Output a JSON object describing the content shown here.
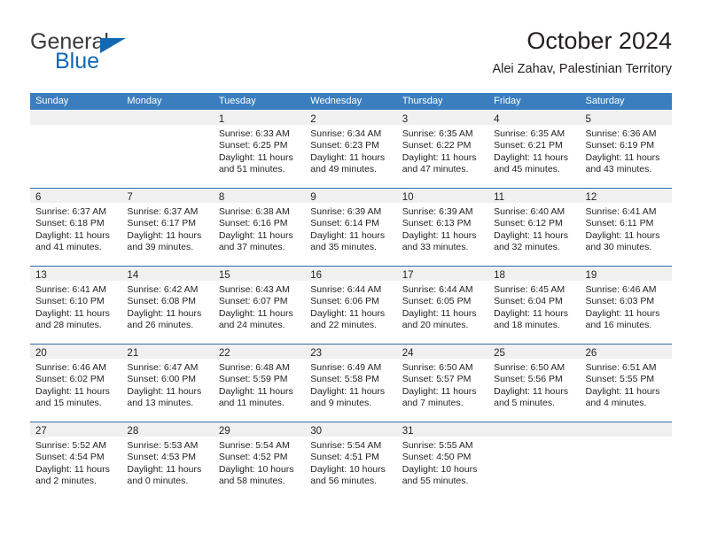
{
  "brand": {
    "name_part1": "General",
    "name_part2": "Blue",
    "triangle_icon": "triangle-icon",
    "accent_color": "#1268b3"
  },
  "header": {
    "title": "October 2024",
    "subtitle": "Alei Zahav, Palestinian Territory"
  },
  "theme": {
    "header_bar_color": "#3a7ebf",
    "week_rule_color": "#2e6da4",
    "day_band_color": "#f0f0f0",
    "text_color": "#231f20"
  },
  "calendar": {
    "weekdays": [
      "Sunday",
      "Monday",
      "Tuesday",
      "Wednesday",
      "Thursday",
      "Friday",
      "Saturday"
    ],
    "weeks": [
      [
        {
          "day": "",
          "empty": true
        },
        {
          "day": "",
          "empty": true
        },
        {
          "day": "1",
          "sunrise": "Sunrise: 6:33 AM",
          "sunset": "Sunset: 6:25 PM",
          "daylight": "Daylight: 11 hours and 51 minutes."
        },
        {
          "day": "2",
          "sunrise": "Sunrise: 6:34 AM",
          "sunset": "Sunset: 6:23 PM",
          "daylight": "Daylight: 11 hours and 49 minutes."
        },
        {
          "day": "3",
          "sunrise": "Sunrise: 6:35 AM",
          "sunset": "Sunset: 6:22 PM",
          "daylight": "Daylight: 11 hours and 47 minutes."
        },
        {
          "day": "4",
          "sunrise": "Sunrise: 6:35 AM",
          "sunset": "Sunset: 6:21 PM",
          "daylight": "Daylight: 11 hours and 45 minutes."
        },
        {
          "day": "5",
          "sunrise": "Sunrise: 6:36 AM",
          "sunset": "Sunset: 6:19 PM",
          "daylight": "Daylight: 11 hours and 43 minutes."
        }
      ],
      [
        {
          "day": "6",
          "sunrise": "Sunrise: 6:37 AM",
          "sunset": "Sunset: 6:18 PM",
          "daylight": "Daylight: 11 hours and 41 minutes."
        },
        {
          "day": "7",
          "sunrise": "Sunrise: 6:37 AM",
          "sunset": "Sunset: 6:17 PM",
          "daylight": "Daylight: 11 hours and 39 minutes."
        },
        {
          "day": "8",
          "sunrise": "Sunrise: 6:38 AM",
          "sunset": "Sunset: 6:16 PM",
          "daylight": "Daylight: 11 hours and 37 minutes."
        },
        {
          "day": "9",
          "sunrise": "Sunrise: 6:39 AM",
          "sunset": "Sunset: 6:14 PM",
          "daylight": "Daylight: 11 hours and 35 minutes."
        },
        {
          "day": "10",
          "sunrise": "Sunrise: 6:39 AM",
          "sunset": "Sunset: 6:13 PM",
          "daylight": "Daylight: 11 hours and 33 minutes."
        },
        {
          "day": "11",
          "sunrise": "Sunrise: 6:40 AM",
          "sunset": "Sunset: 6:12 PM",
          "daylight": "Daylight: 11 hours and 32 minutes."
        },
        {
          "day": "12",
          "sunrise": "Sunrise: 6:41 AM",
          "sunset": "Sunset: 6:11 PM",
          "daylight": "Daylight: 11 hours and 30 minutes."
        }
      ],
      [
        {
          "day": "13",
          "sunrise": "Sunrise: 6:41 AM",
          "sunset": "Sunset: 6:10 PM",
          "daylight": "Daylight: 11 hours and 28 minutes."
        },
        {
          "day": "14",
          "sunrise": "Sunrise: 6:42 AM",
          "sunset": "Sunset: 6:08 PM",
          "daylight": "Daylight: 11 hours and 26 minutes."
        },
        {
          "day": "15",
          "sunrise": "Sunrise: 6:43 AM",
          "sunset": "Sunset: 6:07 PM",
          "daylight": "Daylight: 11 hours and 24 minutes."
        },
        {
          "day": "16",
          "sunrise": "Sunrise: 6:44 AM",
          "sunset": "Sunset: 6:06 PM",
          "daylight": "Daylight: 11 hours and 22 minutes."
        },
        {
          "day": "17",
          "sunrise": "Sunrise: 6:44 AM",
          "sunset": "Sunset: 6:05 PM",
          "daylight": "Daylight: 11 hours and 20 minutes."
        },
        {
          "day": "18",
          "sunrise": "Sunrise: 6:45 AM",
          "sunset": "Sunset: 6:04 PM",
          "daylight": "Daylight: 11 hours and 18 minutes."
        },
        {
          "day": "19",
          "sunrise": "Sunrise: 6:46 AM",
          "sunset": "Sunset: 6:03 PM",
          "daylight": "Daylight: 11 hours and 16 minutes."
        }
      ],
      [
        {
          "day": "20",
          "sunrise": "Sunrise: 6:46 AM",
          "sunset": "Sunset: 6:02 PM",
          "daylight": "Daylight: 11 hours and 15 minutes."
        },
        {
          "day": "21",
          "sunrise": "Sunrise: 6:47 AM",
          "sunset": "Sunset: 6:00 PM",
          "daylight": "Daylight: 11 hours and 13 minutes."
        },
        {
          "day": "22",
          "sunrise": "Sunrise: 6:48 AM",
          "sunset": "Sunset: 5:59 PM",
          "daylight": "Daylight: 11 hours and 11 minutes."
        },
        {
          "day": "23",
          "sunrise": "Sunrise: 6:49 AM",
          "sunset": "Sunset: 5:58 PM",
          "daylight": "Daylight: 11 hours and 9 minutes."
        },
        {
          "day": "24",
          "sunrise": "Sunrise: 6:50 AM",
          "sunset": "Sunset: 5:57 PM",
          "daylight": "Daylight: 11 hours and 7 minutes."
        },
        {
          "day": "25",
          "sunrise": "Sunrise: 6:50 AM",
          "sunset": "Sunset: 5:56 PM",
          "daylight": "Daylight: 11 hours and 5 minutes."
        },
        {
          "day": "26",
          "sunrise": "Sunrise: 6:51 AM",
          "sunset": "Sunset: 5:55 PM",
          "daylight": "Daylight: 11 hours and 4 minutes."
        }
      ],
      [
        {
          "day": "27",
          "sunrise": "Sunrise: 5:52 AM",
          "sunset": "Sunset: 4:54 PM",
          "daylight": "Daylight: 11 hours and 2 minutes."
        },
        {
          "day": "28",
          "sunrise": "Sunrise: 5:53 AM",
          "sunset": "Sunset: 4:53 PM",
          "daylight": "Daylight: 11 hours and 0 minutes."
        },
        {
          "day": "29",
          "sunrise": "Sunrise: 5:54 AM",
          "sunset": "Sunset: 4:52 PM",
          "daylight": "Daylight: 10 hours and 58 minutes."
        },
        {
          "day": "30",
          "sunrise": "Sunrise: 5:54 AM",
          "sunset": "Sunset: 4:51 PM",
          "daylight": "Daylight: 10 hours and 56 minutes."
        },
        {
          "day": "31",
          "sunrise": "Sunrise: 5:55 AM",
          "sunset": "Sunset: 4:50 PM",
          "daylight": "Daylight: 10 hours and 55 minutes."
        },
        {
          "day": "",
          "empty": true
        },
        {
          "day": "",
          "empty": true
        }
      ]
    ]
  }
}
